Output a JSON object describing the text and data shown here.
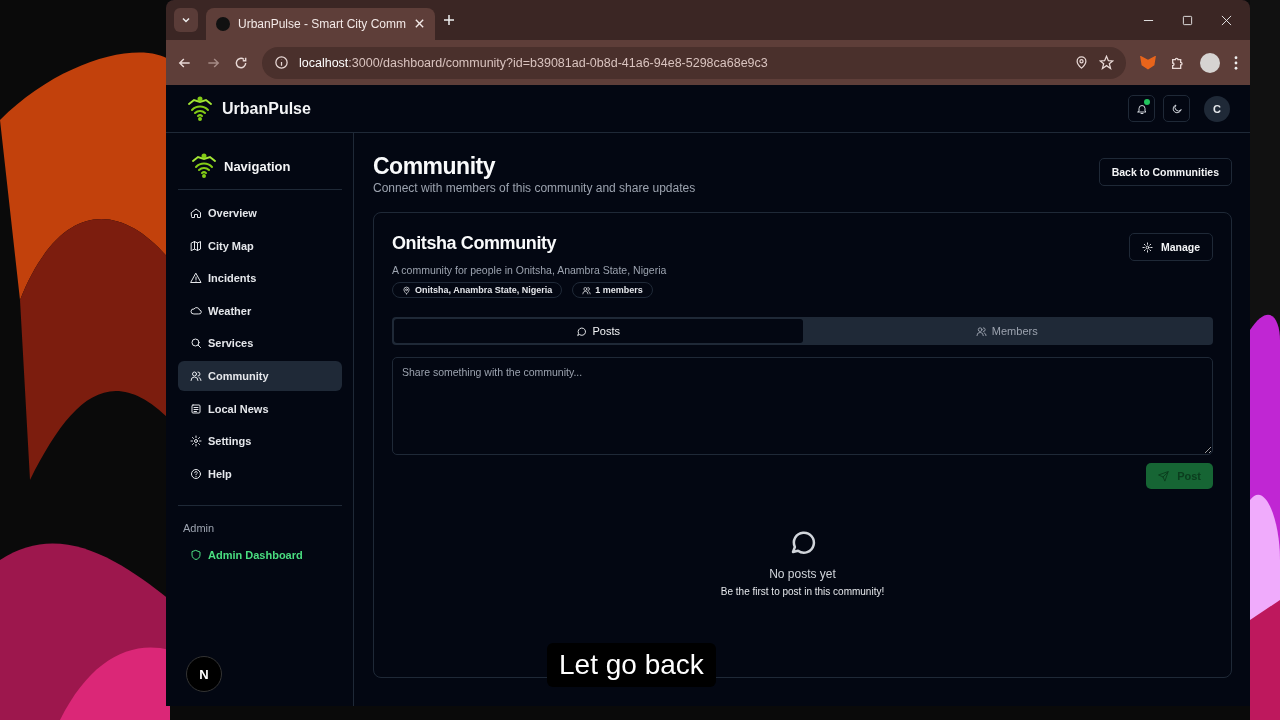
{
  "browser": {
    "tab_title": "UrbanPulse - Smart City Comm",
    "url_host": "localhost",
    "url_rest": ":3000/dashboard/community?id=b39081ad-0b8d-41a6-94e8-5298ca68e9c3"
  },
  "header": {
    "brand": "UrbanPulse",
    "notifications_unread": true,
    "avatar": "C"
  },
  "sidebar": {
    "title": "Navigation",
    "items": [
      {
        "label": "Overview",
        "kind": "home",
        "selected": false
      },
      {
        "label": "City Map",
        "kind": "map",
        "selected": false
      },
      {
        "label": "Incidents",
        "kind": "alert",
        "selected": false
      },
      {
        "label": "Weather",
        "kind": "cloud",
        "selected": false
      },
      {
        "label": "Services",
        "kind": "search",
        "selected": false
      },
      {
        "label": "Community",
        "kind": "users",
        "selected": true
      },
      {
        "label": "Local News",
        "kind": "news",
        "selected": false
      },
      {
        "label": "Settings",
        "kind": "gear",
        "selected": false
      },
      {
        "label": "Help",
        "kind": "help",
        "selected": false
      }
    ],
    "admin_heading": "Admin",
    "admin_items": [
      {
        "label": "Admin Dashboard",
        "kind": "shield",
        "selected": false
      }
    ],
    "footer_badge": "N"
  },
  "page": {
    "title": "Community",
    "subtitle": "Connect with members of this community and share updates",
    "back_button": "Back to Communities"
  },
  "community": {
    "name": "Onitsha Community",
    "description": "A community for people in Onitsha, Anambra State, Nigeria",
    "location": "Onitsha, Anambra State, Nigeria",
    "members": "1 members",
    "manage_button": "Manage",
    "tabs": [
      {
        "label": "Posts",
        "kind": "chat",
        "selected": true
      },
      {
        "label": "Members",
        "kind": "users",
        "selected": false
      }
    ],
    "composer": {
      "placeholder": "Share something with the community..."
    },
    "post_button": {
      "label": "Post",
      "disabled": true
    },
    "empty_state": {
      "title": "No posts yet",
      "text": "Be the first to post in this community!"
    }
  },
  "caption": "Let go back"
}
